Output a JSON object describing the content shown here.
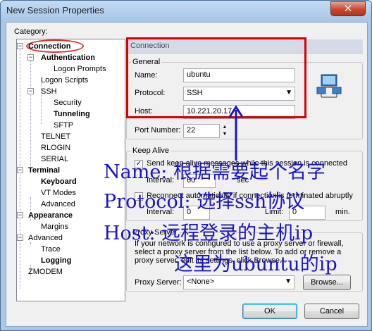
{
  "window": {
    "title": "New Session Properties",
    "close_glyph": "✕"
  },
  "category_label": "Category:",
  "tree": {
    "items": [
      {
        "label": "Connection",
        "bold": true
      },
      {
        "label": "Authentication",
        "bold": true
      },
      {
        "label": "Logon Prompts",
        "bold": false
      },
      {
        "label": "Logon Scripts",
        "bold": false
      },
      {
        "label": "SSH",
        "bold": false
      },
      {
        "label": "Security",
        "bold": false
      },
      {
        "label": "Tunneling",
        "bold": true
      },
      {
        "label": "SFTP",
        "bold": false
      },
      {
        "label": "TELNET",
        "bold": false
      },
      {
        "label": "RLOGIN",
        "bold": false
      },
      {
        "label": "SERIAL",
        "bold": false
      },
      {
        "label": "Terminal",
        "bold": true
      },
      {
        "label": "Keyboard",
        "bold": true
      },
      {
        "label": "VT Modes",
        "bold": false
      },
      {
        "label": "Advanced",
        "bold": false
      },
      {
        "label": "Appearance",
        "bold": true
      },
      {
        "label": "Margins",
        "bold": false
      },
      {
        "label": "Advanced",
        "bold": false
      },
      {
        "label": "Trace",
        "bold": false
      },
      {
        "label": "Logging",
        "bold": true
      },
      {
        "label": "ZMODEM",
        "bold": false
      }
    ]
  },
  "panel": {
    "header": "Connection",
    "general": {
      "title": "General",
      "name_label": "Name:",
      "name_value": "ubuntu",
      "protocol_label": "Protocol:",
      "protocol_value": "SSH",
      "host_label": "Host:",
      "host_value": "10.221.20.17",
      "port_label": "Port Number:",
      "port_value": "22"
    },
    "keepalive": {
      "title": "Keep Alive",
      "send_label": "Send keep alive messages while this session is connected",
      "interval_label": "Interval:",
      "interval_value": "60",
      "seconds_label": "sec",
      "reconnect_label": "Reconnect automatically if connection is terminated abruptly",
      "interval2_label": "Interval:",
      "interval2_value": "0",
      "limit_label": "Limit:",
      "limit_value": "0",
      "min_label": "min."
    },
    "proxy": {
      "title": "Proxy Server",
      "description": "If your network is configured to use a proxy server or firewall, select a proxy server from the list below. To add or remove a proxy server, edit its settings, click Browse...",
      "server_label": "Proxy Server:",
      "server_value": "<None>",
      "browse_label": "Browse..."
    }
  },
  "buttons": {
    "ok": "OK",
    "cancel": "Cancel"
  },
  "annotations": {
    "line1": "Name: 根据需要起个名字",
    "line2": "Protocol: 选择ssh协议",
    "line3": "Host: 远程登录的主机ip",
    "line4": "这里为ubuntu的ip",
    "color": "#1a13c8"
  },
  "highlight_color": "#d90000"
}
